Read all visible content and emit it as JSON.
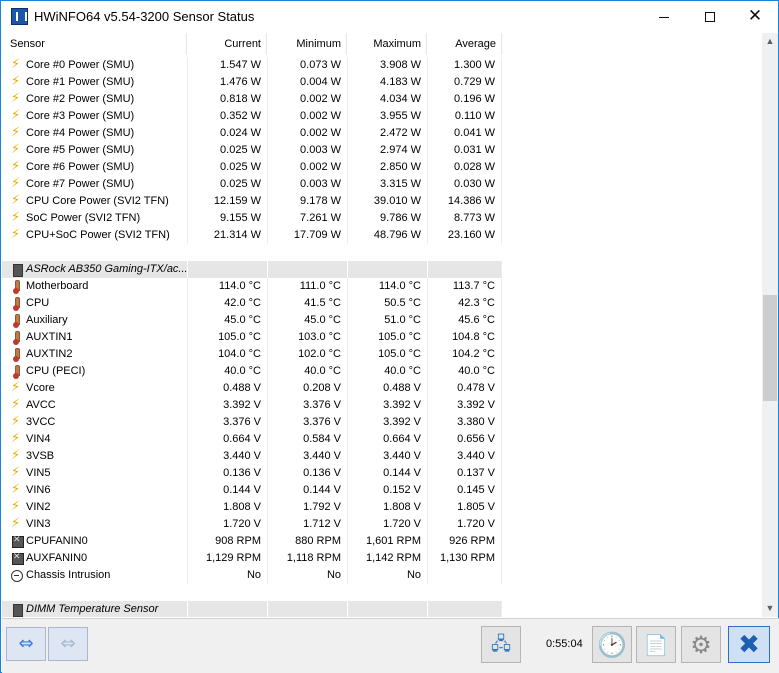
{
  "window": {
    "title": "HWiNFO64 v5.54-3200 Sensor Status",
    "minimize_glyph": "",
    "close_glyph": "✕"
  },
  "columns": [
    "Sensor",
    "Current",
    "Minimum",
    "Maximum",
    "Average"
  ],
  "rows": [
    {
      "kind": "data",
      "icon": "power-icon",
      "name": "Core #0 Power (SMU)",
      "current": "1.547 W",
      "minimum": "0.073 W",
      "maximum": "3.908 W",
      "average": "1.300 W"
    },
    {
      "kind": "data",
      "icon": "power-icon",
      "name": "Core #1 Power (SMU)",
      "current": "1.476 W",
      "minimum": "0.004 W",
      "maximum": "4.183 W",
      "average": "0.729 W"
    },
    {
      "kind": "data",
      "icon": "power-icon",
      "name": "Core #2 Power (SMU)",
      "current": "0.818 W",
      "minimum": "0.002 W",
      "maximum": "4.034 W",
      "average": "0.196 W"
    },
    {
      "kind": "data",
      "icon": "power-icon",
      "name": "Core #3 Power (SMU)",
      "current": "0.352 W",
      "minimum": "0.002 W",
      "maximum": "3.955 W",
      "average": "0.110 W"
    },
    {
      "kind": "data",
      "icon": "power-icon",
      "name": "Core #4 Power (SMU)",
      "current": "0.024 W",
      "minimum": "0.002 W",
      "maximum": "2.472 W",
      "average": "0.041 W"
    },
    {
      "kind": "data",
      "icon": "power-icon",
      "name": "Core #5 Power (SMU)",
      "current": "0.025 W",
      "minimum": "0.003 W",
      "maximum": "2.974 W",
      "average": "0.031 W"
    },
    {
      "kind": "data",
      "icon": "power-icon",
      "name": "Core #6 Power (SMU)",
      "current": "0.025 W",
      "minimum": "0.002 W",
      "maximum": "2.850 W",
      "average": "0.028 W"
    },
    {
      "kind": "data",
      "icon": "power-icon",
      "name": "Core #7 Power (SMU)",
      "current": "0.025 W",
      "minimum": "0.003 W",
      "maximum": "3.315 W",
      "average": "0.030 W"
    },
    {
      "kind": "data",
      "icon": "power-icon",
      "name": "CPU Core Power (SVI2 TFN)",
      "current": "12.159 W",
      "minimum": "9.178 W",
      "maximum": "39.010 W",
      "average": "14.386 W"
    },
    {
      "kind": "data",
      "icon": "power-icon",
      "name": "SoC Power (SVI2 TFN)",
      "current": "9.155 W",
      "minimum": "7.261 W",
      "maximum": "9.786 W",
      "average": "8.773 W"
    },
    {
      "kind": "data",
      "icon": "power-icon",
      "name": "CPU+SoC Power (SVI2 TFN)",
      "current": "21.314 W",
      "minimum": "17.709 W",
      "maximum": "48.796 W",
      "average": "23.160 W"
    },
    {
      "kind": "blank"
    },
    {
      "kind": "group",
      "icon": "chip-icon",
      "name": "ASRock AB350 Gaming-ITX/ac..."
    },
    {
      "kind": "data",
      "icon": "thermometer-icon",
      "name": "Motherboard",
      "current": "114.0 °C",
      "minimum": "111.0 °C",
      "maximum": "114.0 °C",
      "average": "113.7 °C"
    },
    {
      "kind": "data",
      "icon": "thermometer-icon",
      "name": "CPU",
      "current": "42.0 °C",
      "minimum": "41.5 °C",
      "maximum": "50.5 °C",
      "average": "42.3 °C"
    },
    {
      "kind": "data",
      "icon": "thermometer-icon",
      "name": "Auxiliary",
      "current": "45.0 °C",
      "minimum": "45.0 °C",
      "maximum": "51.0 °C",
      "average": "45.6 °C"
    },
    {
      "kind": "data",
      "icon": "thermometer-icon",
      "name": "AUXTIN1",
      "current": "105.0 °C",
      "minimum": "103.0 °C",
      "maximum": "105.0 °C",
      "average": "104.8 °C"
    },
    {
      "kind": "data",
      "icon": "thermometer-icon",
      "name": "AUXTIN2",
      "current": "104.0 °C",
      "minimum": "102.0 °C",
      "maximum": "105.0 °C",
      "average": "104.2 °C"
    },
    {
      "kind": "data",
      "icon": "thermometer-icon",
      "name": "CPU (PECI)",
      "current": "40.0 °C",
      "minimum": "40.0 °C",
      "maximum": "40.0 °C",
      "average": "40.0 °C"
    },
    {
      "kind": "data",
      "icon": "power-icon",
      "name": "Vcore",
      "current": "0.488 V",
      "minimum": "0.208 V",
      "maximum": "0.488 V",
      "average": "0.478 V"
    },
    {
      "kind": "data",
      "icon": "power-icon",
      "name": "AVCC",
      "current": "3.392 V",
      "minimum": "3.376 V",
      "maximum": "3.392 V",
      "average": "3.392 V"
    },
    {
      "kind": "data",
      "icon": "power-icon",
      "name": "3VCC",
      "current": "3.376 V",
      "minimum": "3.376 V",
      "maximum": "3.392 V",
      "average": "3.380 V"
    },
    {
      "kind": "data",
      "icon": "power-icon",
      "name": "VIN4",
      "current": "0.664 V",
      "minimum": "0.584 V",
      "maximum": "0.664 V",
      "average": "0.656 V"
    },
    {
      "kind": "data",
      "icon": "power-icon",
      "name": "3VSB",
      "current": "3.440 V",
      "minimum": "3.440 V",
      "maximum": "3.440 V",
      "average": "3.440 V"
    },
    {
      "kind": "data",
      "icon": "power-icon",
      "name": "VIN5",
      "current": "0.136 V",
      "minimum": "0.136 V",
      "maximum": "0.144 V",
      "average": "0.137 V"
    },
    {
      "kind": "data",
      "icon": "power-icon",
      "name": "VIN6",
      "current": "0.144 V",
      "minimum": "0.144 V",
      "maximum": "0.152 V",
      "average": "0.145 V"
    },
    {
      "kind": "data",
      "icon": "power-icon",
      "name": "VIN2",
      "current": "1.808 V",
      "minimum": "1.792 V",
      "maximum": "1.808 V",
      "average": "1.805 V"
    },
    {
      "kind": "data",
      "icon": "power-icon",
      "name": "VIN3",
      "current": "1.720 V",
      "minimum": "1.712 V",
      "maximum": "1.720 V",
      "average": "1.720 V"
    },
    {
      "kind": "data",
      "icon": "fan-icon",
      "name": "CPUFANIN0",
      "current": "908 RPM",
      "minimum": "880 RPM",
      "maximum": "1,601 RPM",
      "average": "926 RPM"
    },
    {
      "kind": "data",
      "icon": "fan-icon",
      "name": "AUXFANIN0",
      "current": "1,129 RPM",
      "minimum": "1,118 RPM",
      "maximum": "1,142 RPM",
      "average": "1,130 RPM"
    },
    {
      "kind": "data",
      "icon": "intrusion-icon",
      "name": "Chassis Intrusion",
      "current": "No",
      "minimum": "No",
      "maximum": "No",
      "average": ""
    },
    {
      "kind": "blank"
    },
    {
      "kind": "group",
      "icon": "chip-icon",
      "name": "DIMM Temperature Sensor"
    }
  ],
  "scrollbar": {
    "up_glyph": "▲",
    "down_glyph": "▼"
  },
  "toolbar": {
    "nav_left_glyph": "⇔",
    "nav_right_glyph": "⇔",
    "network_glyph": "🖧",
    "timer": "0:55:04",
    "clock_glyph": "🕑",
    "report_glyph": "📄",
    "settings_glyph": "⚙",
    "close_glyph": "✖"
  }
}
